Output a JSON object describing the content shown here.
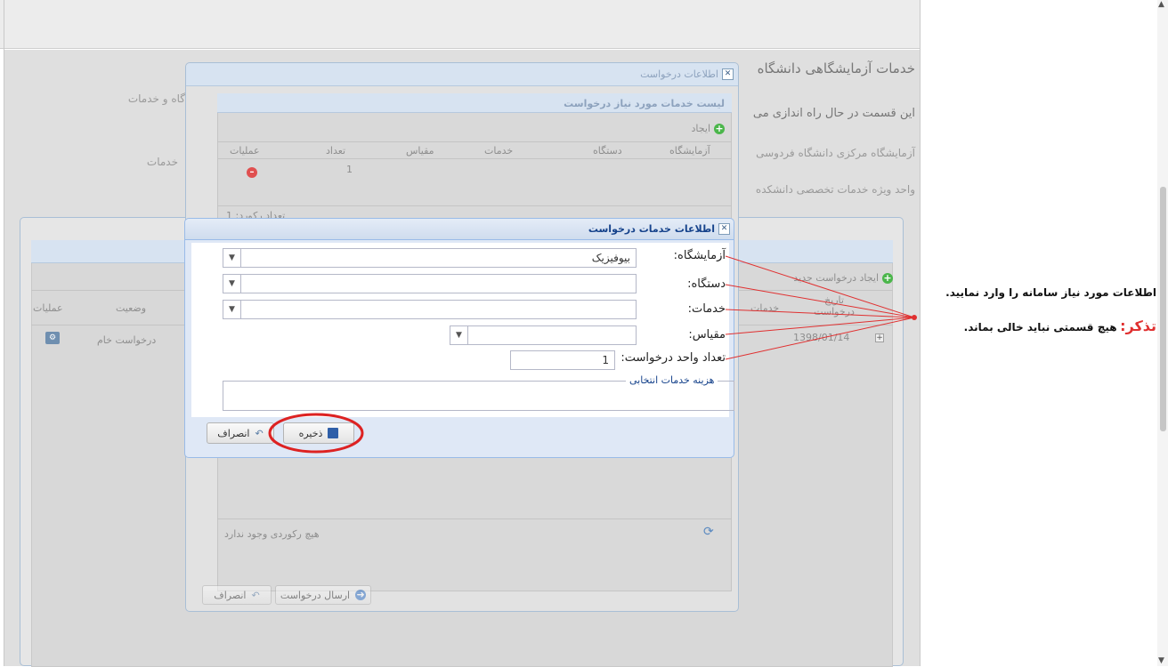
{
  "background": {
    "heading": "خدمات آزمایشگاهی دانشگاه",
    "line1": "این قسمت در حال راه اندازی می",
    "link1": "آزمایشگاه مرکزی دانشگاه فردوسی",
    "link2": "واحد ویژه خدمات تخصصی دانشکده",
    "left_text1": "گاه و خدمات",
    "left_text2": "خدمات"
  },
  "requests_window": {
    "create_label": "ایجاد درخواست جدید",
    "columns": [
      "تاریخ درخواست",
      "خدمات",
      "وضعیت",
      "عملیات"
    ],
    "row": {
      "date": "1398/01/14",
      "status": "درخواست خام"
    }
  },
  "request_info_window": {
    "title": "اطلاعات درخواست",
    "services_list_title": "لیست خدمات مورد نیاز درخواست",
    "create_label": "ایجاد",
    "columns": [
      "آزمایشگاه",
      "دستگاه",
      "خدمات",
      "مقیاس",
      "تعداد",
      "عملیات"
    ],
    "row": {
      "count": "1"
    },
    "footer_partial": "تعداد رکورد: 1",
    "no_records": "هیچ رکوردی وجود ندارد",
    "send_button": "ارسال درخواست",
    "cancel_button": "انصراف"
  },
  "service_dialog": {
    "title": "اطلاعات خدمات درخواست",
    "lab_label": "آزمایشگاه:",
    "lab_value": "بیوفیزیک",
    "device_label": "دستگاه:",
    "device_value": "",
    "service_label": "خدمات:",
    "service_value": "",
    "scale_label": "مقیاس:",
    "scale_value": "",
    "qty_label": "تعداد واحد درخواست:",
    "qty_value": "1",
    "cost_legend": "هزینه خدمات انتخابی",
    "save_button": "ذخیره",
    "cancel_button": "انصراف"
  },
  "annotation": {
    "line1": "اطلاعات مورد نیاز سامانه را وارد نمایید.",
    "reminder_label": "تذکر:",
    "reminder_text": "هیچ قسمتی نباید خالی بماند.",
    "color": "#e03030"
  }
}
